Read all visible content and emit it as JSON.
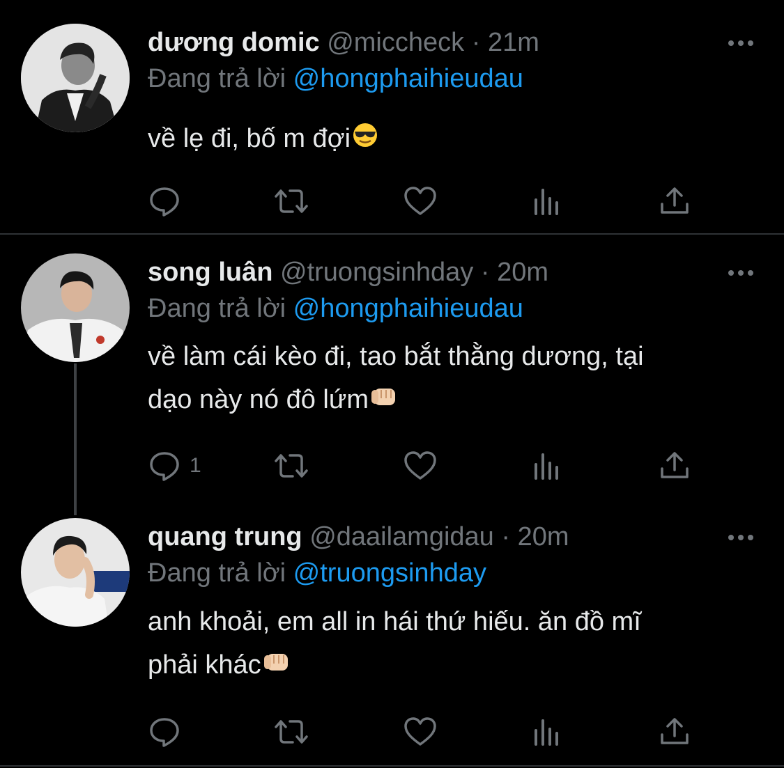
{
  "tweets": [
    {
      "display_name": "dương domic",
      "handle": "@miccheck",
      "separator": "·",
      "time": "21m",
      "replying_prefix": "Đang trả lời",
      "replying_to": "@hongphaihieudau",
      "text": "về lẹ đi, bố m đợi",
      "emoji": "smiling-face-with-sunglasses",
      "reply_count": "",
      "avatar": "profile-photo-black-white-man-suit"
    },
    {
      "display_name": "song luân",
      "handle": "@truongsinhday",
      "separator": "·",
      "time": "20m",
      "replying_prefix": "Đang trả lời",
      "replying_to": "@hongphaihieudau",
      "text_line1": "về làm cái kèo đi, tao bắt thằng dương, tại",
      "text_line2": "dạo này nó đô lứm",
      "emoji": "oncoming-fist",
      "reply_count": "1",
      "avatar": "profile-photo-man-white-shirt-tie"
    },
    {
      "display_name": "quang trung",
      "handle": "@daailamgidau",
      "separator": "·",
      "time": "20m",
      "replying_prefix": "Đang trả lời",
      "replying_to": "@truongsinhday",
      "text_line1": "anh khoải, em all in hái thứ hiếu. ăn đồ mĩ",
      "text_line2": "phải khác",
      "emoji": "oncoming-fist",
      "reply_count": "",
      "avatar": "profile-photo-man-white-shirt-hand-on-face"
    }
  ],
  "icons": [
    "reply-icon",
    "retweet-icon",
    "like-icon",
    "analytics-icon",
    "share-icon",
    "more-icon"
  ],
  "colors": {
    "background": "#000000",
    "text": "#E7E9EA",
    "muted": "#71767B",
    "link": "#1D9BF0",
    "divider": "#2F3336"
  }
}
